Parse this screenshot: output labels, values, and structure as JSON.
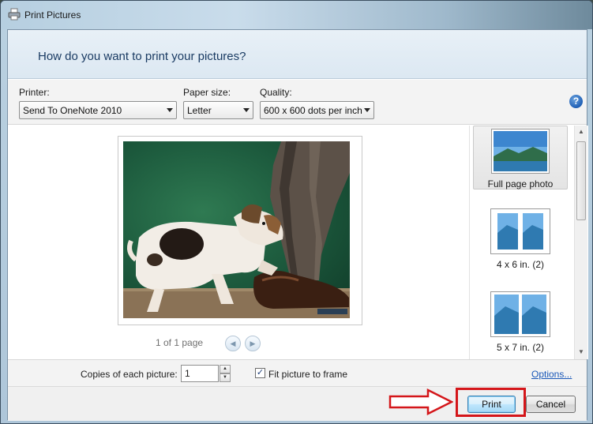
{
  "window": {
    "title": "Print Pictures",
    "question": "How do you want to print your pictures?"
  },
  "options": {
    "printer_label": "Printer:",
    "printer_value": "Send To OneNote 2010",
    "paper_label": "Paper size:",
    "paper_value": "Letter",
    "quality_label": "Quality:",
    "quality_value": "600 x 600 dots per inch",
    "help_glyph": "?"
  },
  "preview": {
    "page_indicator": "1 of 1 page",
    "prev_glyph": "◀",
    "next_glyph": "▶"
  },
  "layouts": [
    {
      "label": "Full page photo",
      "selected": true
    },
    {
      "label": "4 x 6 in. (2)",
      "selected": false
    },
    {
      "label": "5 x 7 in. (2)",
      "selected": false
    }
  ],
  "bottom": {
    "copies_label": "Copies of each picture:",
    "copies_value": "1",
    "fit_checked": "✓",
    "fit_label": "Fit picture to frame",
    "options_link": "Options..."
  },
  "footer": {
    "print_label": "Print",
    "cancel_label": "Cancel"
  },
  "colors": {
    "annotation_red": "#d4161a",
    "link_blue": "#1a58b8"
  }
}
